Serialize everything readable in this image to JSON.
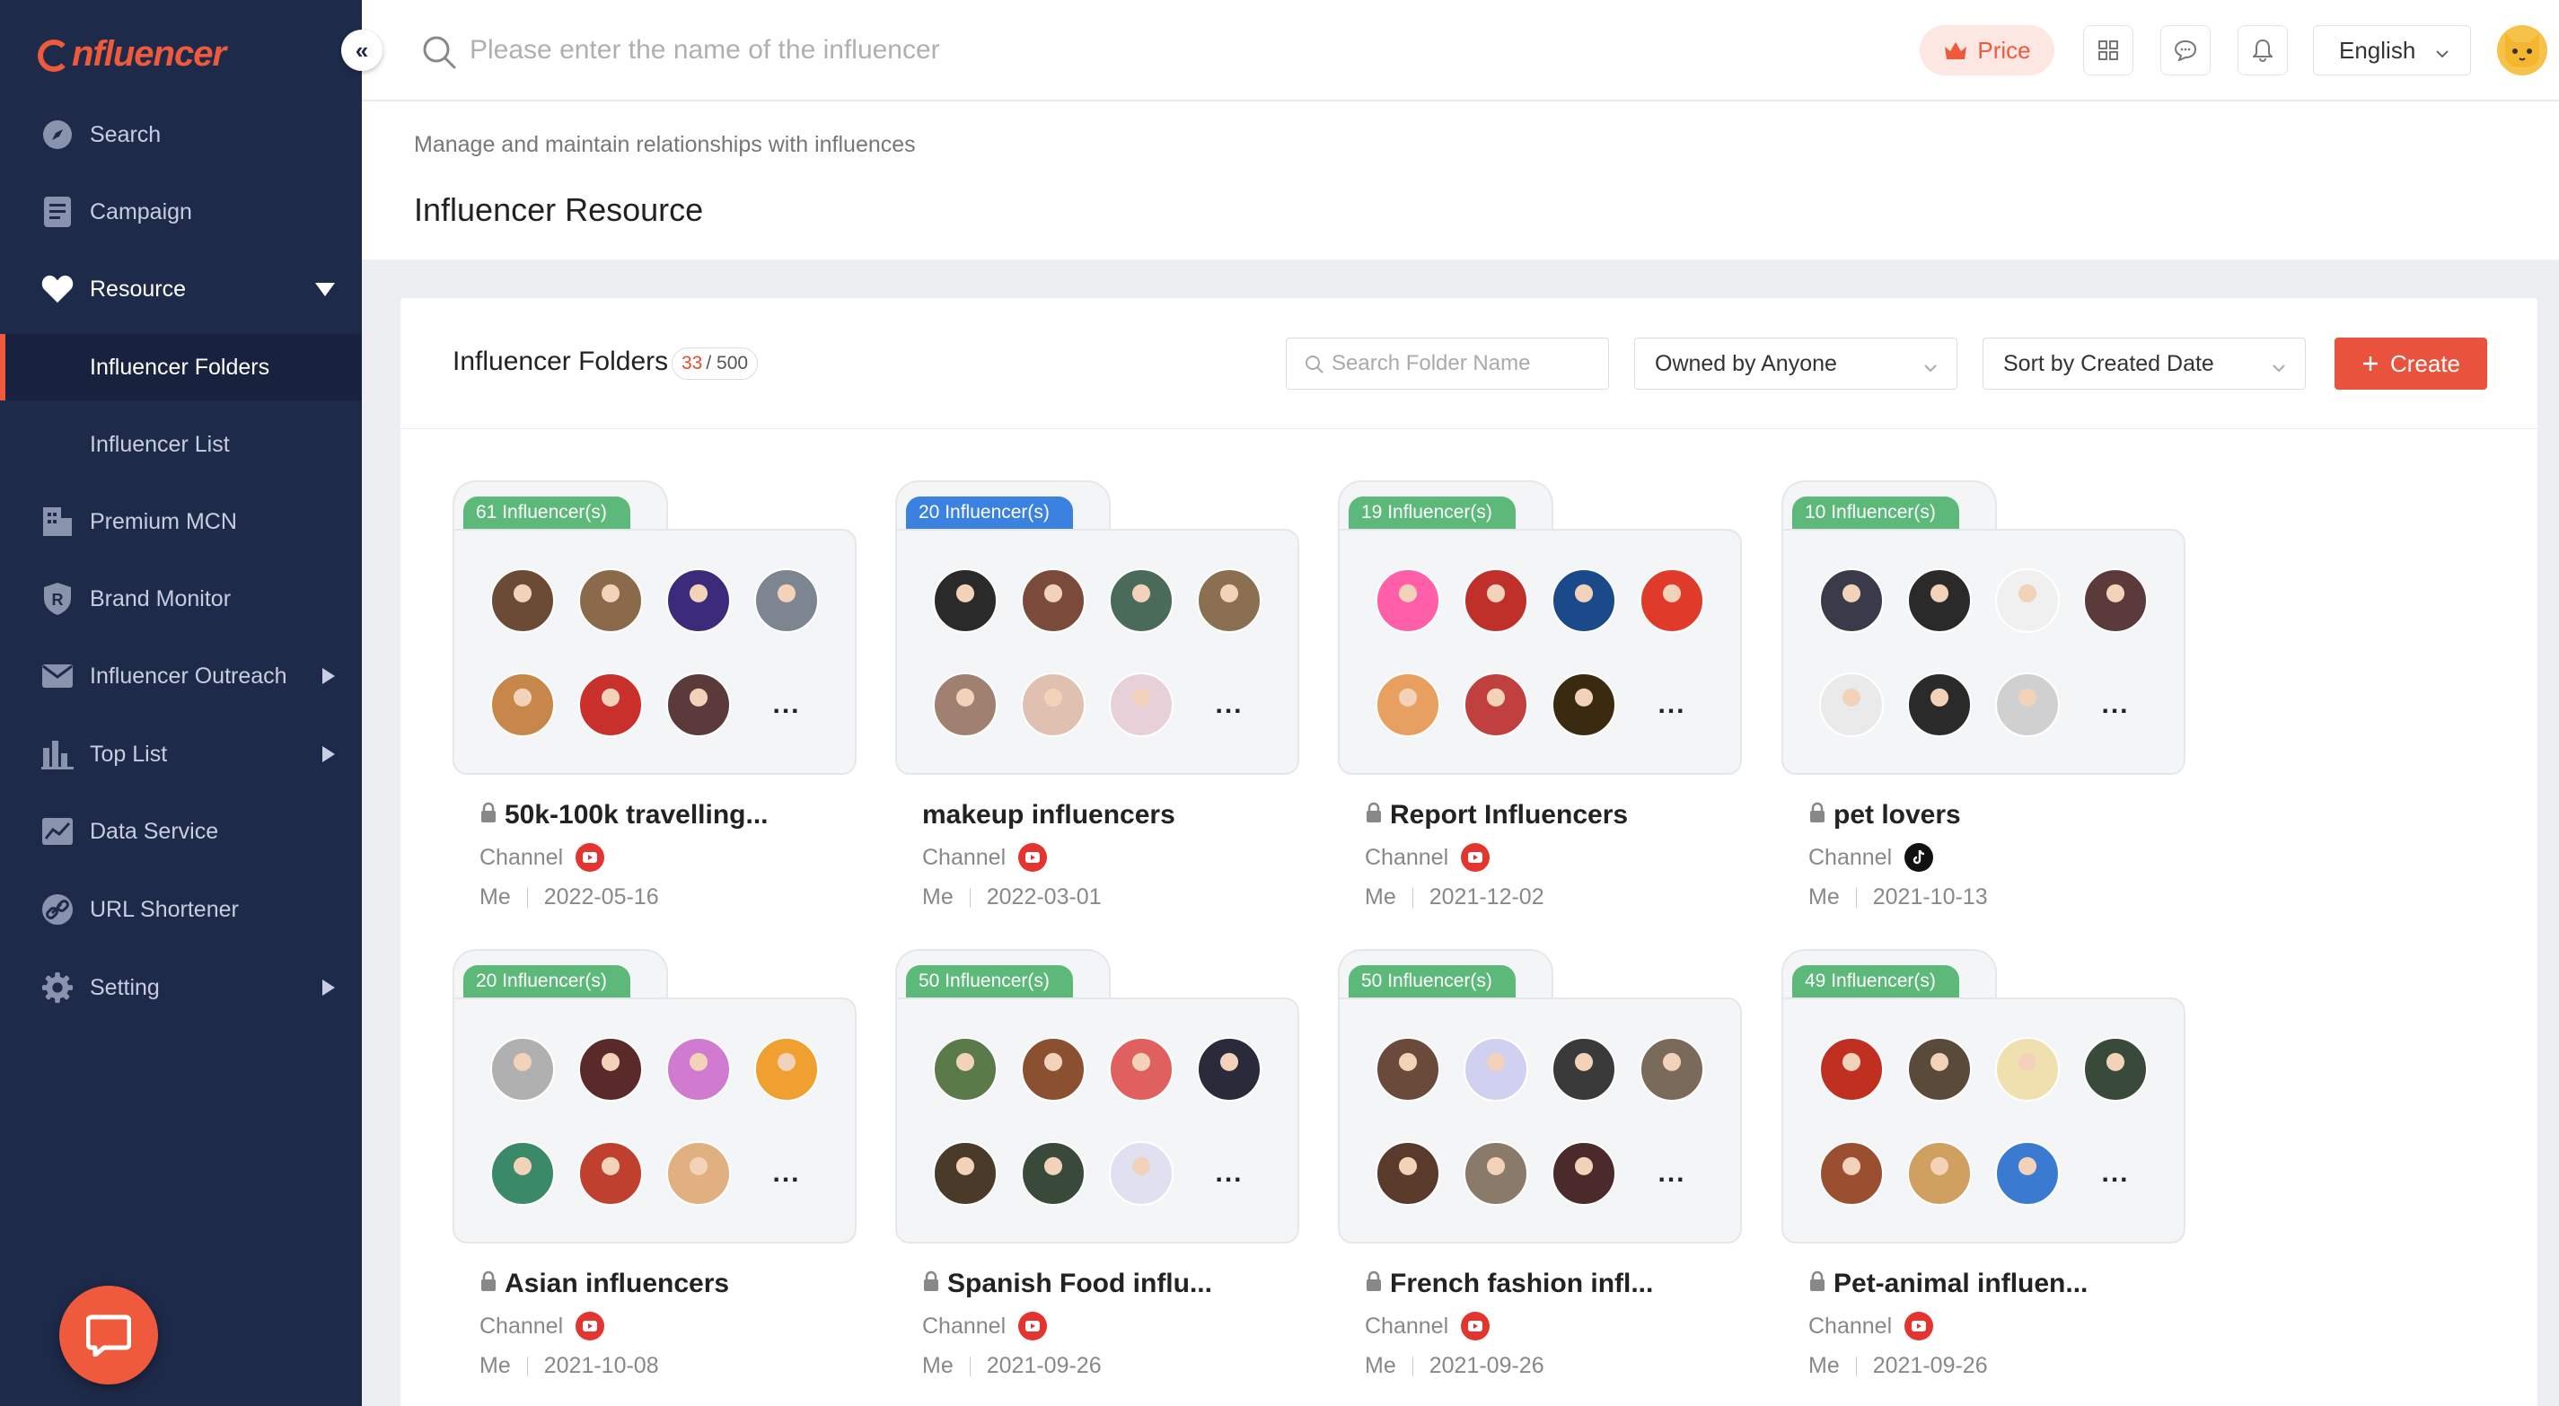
{
  "brand": {
    "name": "nfluencer",
    "accent": "#f05a3c",
    "sidebar_bg": "#1e2a4a"
  },
  "sidebar": {
    "collapse_label": "«",
    "items": [
      {
        "label": "Search",
        "icon": "compass-icon"
      },
      {
        "label": "Campaign",
        "icon": "document-icon"
      },
      {
        "label": "Resource",
        "icon": "heart-icon",
        "expanded": true
      },
      {
        "label": "Premium MCN",
        "icon": "building-icon"
      },
      {
        "label": "Brand Monitor",
        "icon": "shield-r-icon"
      },
      {
        "label": "Influencer Outreach",
        "icon": "mail-icon",
        "has_submenu": true
      },
      {
        "label": "Top List",
        "icon": "bar-chart-icon",
        "has_submenu": true
      },
      {
        "label": "Data Service",
        "icon": "line-chart-icon"
      },
      {
        "label": "URL Shortener",
        "icon": "link-icon"
      },
      {
        "label": "Setting",
        "icon": "gear-icon",
        "has_submenu": true
      }
    ],
    "sub_items": [
      {
        "label": "Influencer Folders",
        "selected": true
      },
      {
        "label": "Influencer List",
        "selected": false
      }
    ]
  },
  "topbar": {
    "search_placeholder": "Please enter the name of the influencer",
    "price_label": "Price",
    "language": "English"
  },
  "page": {
    "subtitle": "Manage and maintain relationships with influences",
    "title": "Influencer Resource"
  },
  "panel": {
    "title": "Influencer Folders",
    "count_current": "33",
    "count_total": "/ 500",
    "search_placeholder": "Search Folder Name",
    "owner_filter": "Owned by Anyone",
    "sort": "Sort by Created Date",
    "create_label": "Create"
  },
  "folders": [
    {
      "count": "61 Influencer(s)",
      "tag_color": "green",
      "name": "50k-100k travelling...",
      "locked": true,
      "channel_label": "Channel",
      "platform": "youtube",
      "owner": "Me",
      "date": "2022-05-16"
    },
    {
      "count": "20 Influencer(s)",
      "tag_color": "blue",
      "name": "makeup influencers",
      "locked": false,
      "channel_label": "Channel",
      "platform": "youtube",
      "owner": "Me",
      "date": "2022-03-01"
    },
    {
      "count": "19 Influencer(s)",
      "tag_color": "green",
      "name": "Report Influencers",
      "locked": true,
      "channel_label": "Channel",
      "platform": "youtube",
      "owner": "Me",
      "date": "2021-12-02"
    },
    {
      "count": "10 Influencer(s)",
      "tag_color": "green",
      "name": "pet lovers",
      "locked": true,
      "channel_label": "Channel",
      "platform": "tiktok",
      "owner": "Me",
      "date": "2021-10-13"
    },
    {
      "count": "20 Influencer(s)",
      "tag_color": "green",
      "name": "Asian influencers",
      "locked": true,
      "channel_label": "Channel",
      "platform": "youtube",
      "owner": "Me",
      "date": "2021-10-08"
    },
    {
      "count": "50 Influencer(s)",
      "tag_color": "green",
      "name": "Spanish Food influ...",
      "locked": true,
      "channel_label": "Channel",
      "platform": "youtube",
      "owner": "Me",
      "date": "2021-09-26"
    },
    {
      "count": "50 Influencer(s)",
      "tag_color": "green",
      "name": "French fashion infl...",
      "locked": true,
      "channel_label": "Channel",
      "platform": "youtube",
      "owner": "Me",
      "date": "2021-09-26"
    },
    {
      "count": "49 Influencer(s)",
      "tag_color": "green",
      "name": "Pet-animal influen...",
      "locked": true,
      "channel_label": "Channel",
      "platform": "youtube",
      "owner": "Me",
      "date": "2021-09-26"
    }
  ],
  "more_label": "..."
}
